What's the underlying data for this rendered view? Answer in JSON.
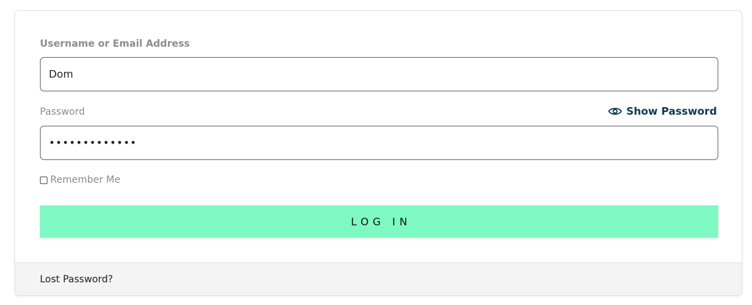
{
  "login_form": {
    "username": {
      "label": "Username or Email Address",
      "value": "Dom"
    },
    "password": {
      "label": "Password",
      "value": "•••••••••••••",
      "show_password_label": "Show Password",
      "show_password_icon": "eye-icon"
    },
    "remember_me": {
      "label": "Remember Me",
      "checked": false
    },
    "login_button_label": "LOG IN",
    "lost_password_label": "Lost Password?"
  },
  "colors": {
    "button_bg": "#7ef9c3",
    "show_password_text": "#0c3a4f",
    "label_text": "#8c8c8c",
    "footer_bg": "#f4f4f4"
  }
}
